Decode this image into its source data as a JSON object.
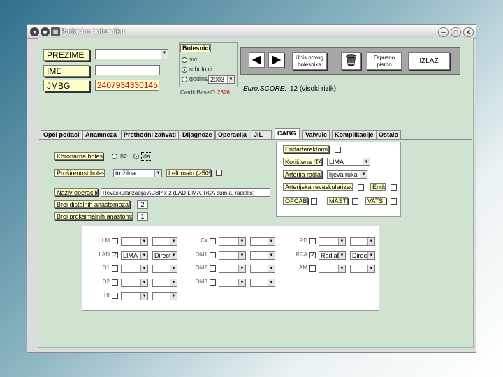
{
  "window": {
    "title": "Podaci o bolesniku",
    "min": "─",
    "max": "□",
    "close": "✕"
  },
  "patient": {
    "prezime_label": "PREZIME",
    "ime_label": "IME",
    "jmbg_label": "JMBG",
    "prezime_value": "",
    "ime_value": "",
    "jmbg_value": "2407934330145"
  },
  "bolesnici": {
    "title": "Bolesnici",
    "opt_svi": "svi",
    "opt_u_bolnici": "u bolnici",
    "opt_godina": "godina",
    "year": "2003"
  },
  "cardiobase": {
    "label": "CardioBaseID:",
    "value": "2626"
  },
  "euroscore": {
    "label": "Euro.SCORE:",
    "value": "12 (visoki rizik)"
  },
  "nav": {
    "btn_new": "Upis novog bolesnika",
    "btn_discharge": "Otpusno pismo",
    "btn_exit": "IZLAZ"
  },
  "tabs": [
    "Opći podaci",
    "Anamneza",
    "Prethodni zahvati",
    "Dijagnoze",
    "Operacija",
    "JIL",
    "CABG",
    "Valvule",
    "Komplikacije",
    "Ostalo"
  ],
  "cabg": {
    "koronarna_label": "Koronarna bolest",
    "radio_ne": "ne",
    "radio_da": "da",
    "prosirenost_label": "Proširenost bolesti",
    "prosirenost_value": "trožilna",
    "leftmain_label": "Left main (>50%)",
    "naziv_label": "Naziv operacije",
    "naziv_value": "Revaskularizacija ACBP x 2 (LAD LIMA, RCA cum a. radialis)",
    "distalne_label": "Broj distalnih anastomoza",
    "distalne_value": "2",
    "proksimalne_label": "Broj proksimalnih anastomoza",
    "proksimalne_value": "1",
    "endarterektomija_label": "Endarterektomija",
    "koristena_label": "Korištena ITA",
    "koristena_value": "LIMA",
    "arterija_label": "Arterija radialis",
    "arterija_value": "lijeva ruka",
    "arterijska_label": "Arterijska revaskularizacija",
    "endo_label": "Endo",
    "opcab_label": "OPCAB",
    "mast_label": "MAST",
    "vats_label": "VATS"
  },
  "grafts": {
    "col1": [
      {
        "label": "LM",
        "checked": "",
        "g": "",
        "t": ""
      },
      {
        "label": "LAD",
        "checked": "✓",
        "g": "LIMA",
        "t": "Direct"
      },
      {
        "label": "D1",
        "checked": "",
        "g": "",
        "t": ""
      },
      {
        "label": "D2",
        "checked": "",
        "g": "",
        "t": ""
      },
      {
        "label": "RI",
        "checked": "",
        "g": "",
        "t": ""
      }
    ],
    "col2": [
      {
        "label": "Cx",
        "checked": "",
        "g": "",
        "t": ""
      },
      {
        "label": "OM1",
        "checked": "",
        "g": "",
        "t": ""
      },
      {
        "label": "OM2",
        "checked": "",
        "g": "",
        "t": ""
      },
      {
        "label": "OM3",
        "checked": "",
        "g": "",
        "t": ""
      }
    ],
    "col3": [
      {
        "label": "RD",
        "checked": "",
        "g": "",
        "t": ""
      },
      {
        "label": "RCA",
        "checked": "✓",
        "g": "Radial",
        "t": "Direct"
      },
      {
        "label": "AM",
        "checked": "",
        "g": "",
        "t": ""
      }
    ]
  },
  "colors": {
    "client_bg": "#cfe3d0",
    "label_bg": "#ffffcc",
    "jmbg_red": "#d00000",
    "nav_panel": "#a7a7a7"
  },
  "icons": [
    "arrow-left-icon",
    "arrow-right-icon",
    "trash-icon"
  ]
}
